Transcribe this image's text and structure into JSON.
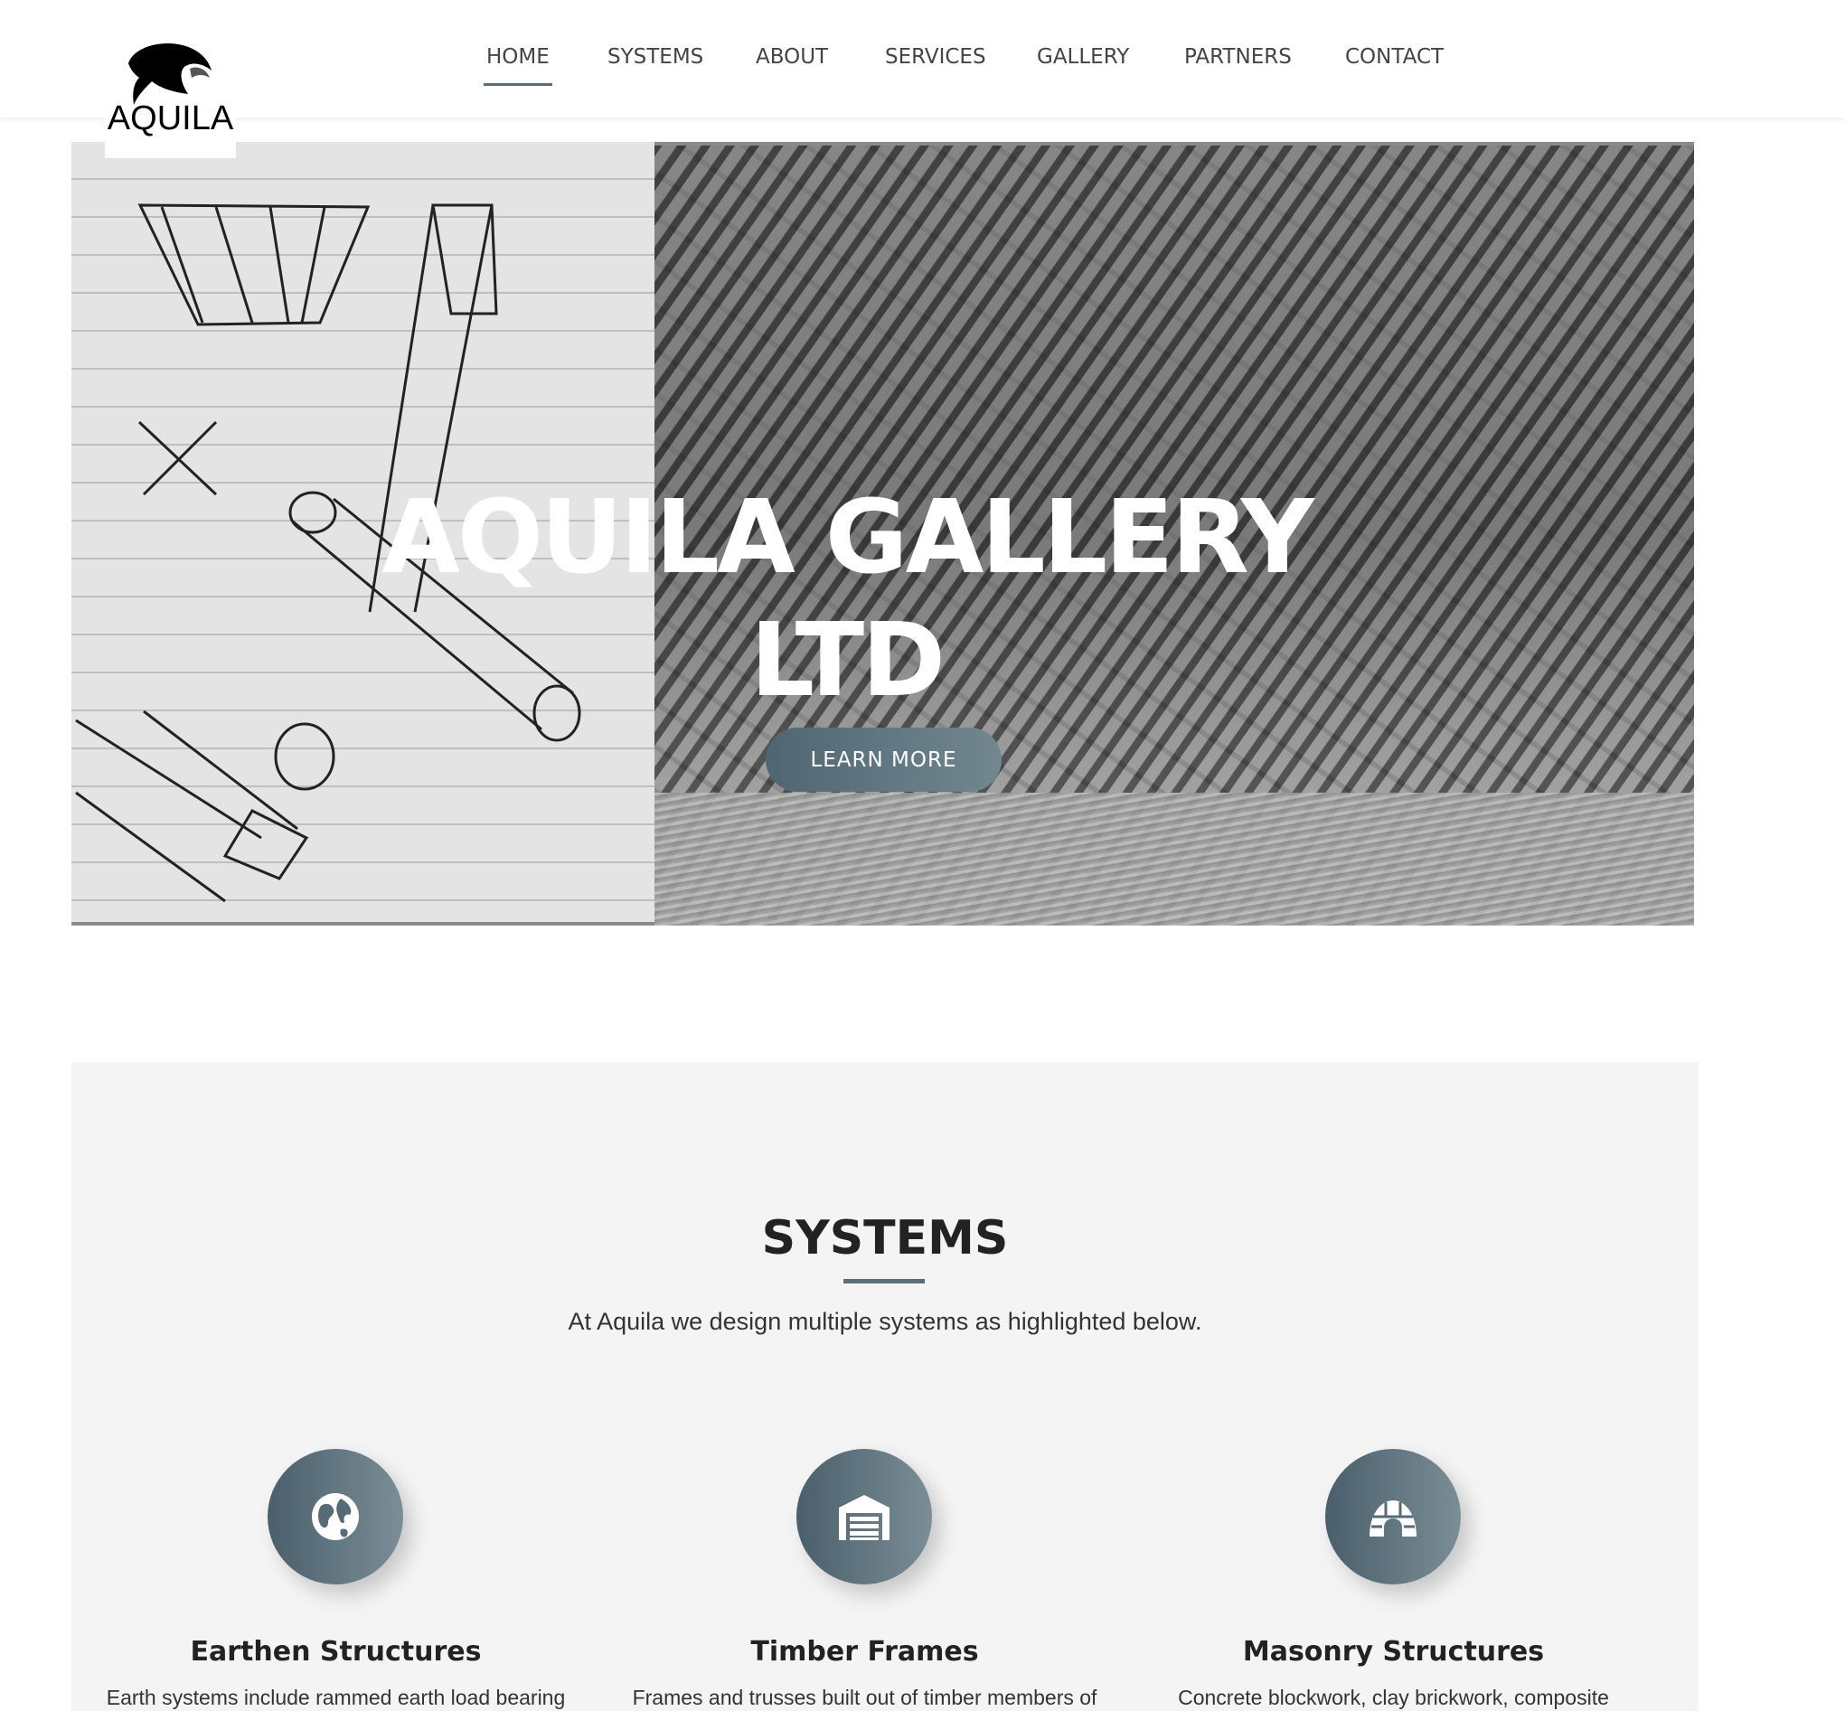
{
  "brand": {
    "logo_text": "AQUILA"
  },
  "nav": {
    "items": [
      {
        "label": "HOME",
        "active": true
      },
      {
        "label": "SYSTEMS",
        "active": false
      },
      {
        "label": "ABOUT",
        "active": false
      },
      {
        "label": "SERVICES",
        "active": false
      },
      {
        "label": "GALLERY",
        "active": false
      },
      {
        "label": "PARTNERS",
        "active": false
      },
      {
        "label": "CONTACT",
        "active": false
      }
    ]
  },
  "hero": {
    "title_line1": "AQUILA GALLERY",
    "title_line2": "LTD",
    "button_label": "LEARN MORE"
  },
  "systems": {
    "title": "SYSTEMS",
    "subtitle": "At Aquila we design multiple systems as highlighted below.",
    "cards": [
      {
        "icon": "globe-icon",
        "title": "Earthen Structures",
        "text": "Earth systems include rammed earth load bearing"
      },
      {
        "icon": "warehouse-icon",
        "title": "Timber Frames",
        "text": "Frames and trusses built out of timber members of"
      },
      {
        "icon": "igloo-icon",
        "title": "Masonry Structures",
        "text": "Concrete blockwork, clay brickwork, composite"
      }
    ]
  },
  "colors": {
    "accent": "#5a6f7a",
    "button_gradient_start": "#4f6672",
    "button_gradient_end": "#72878f",
    "section_bg": "#f4f4f4"
  }
}
